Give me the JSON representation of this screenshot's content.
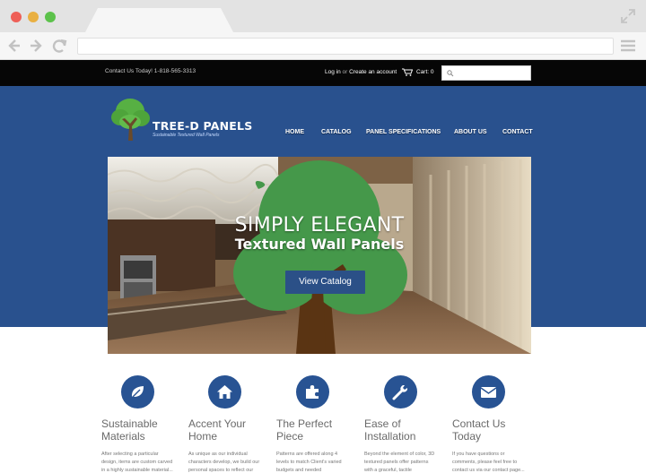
{
  "site": {
    "contact": "Contact Us Today! 1-818-565-3313",
    "login": "Log in",
    "or": "or",
    "create_account": "Create an account",
    "cart": "Cart: 0"
  },
  "logo": {
    "title": "TREE-D PANELS",
    "tagline": "Sustainable Textured Wall Panels"
  },
  "nav": [
    "HOME",
    "CATALOG",
    "PANEL SPECIFICATIONS",
    "ABOUT US",
    "CONTACT"
  ],
  "hero": {
    "line1": "SIMPLY ELEGANT",
    "line2": "Textured Wall Panels",
    "button": "View Catalog"
  },
  "features": [
    {
      "icon": "leaf-icon",
      "title1": "Sustainable",
      "title2": "Materials",
      "body1": "After selecting a particular",
      "body2": "design, items are custom carved",
      "body3": "in a highly sustainable material..."
    },
    {
      "icon": "home-icon",
      "title1": "Accent Your",
      "title2": "Home",
      "body1": "As unique as our individual",
      "body2": "characters develop, we build our",
      "body3": "personal spaces to reflect our"
    },
    {
      "icon": "puzzle-icon",
      "title1": "The Perfect",
      "title2": "Piece",
      "body1": "Patterns are offered along 4",
      "body2": "levels to match Client's varied",
      "body3": "budgets and needed"
    },
    {
      "icon": "wrench-icon",
      "title1": "Ease of",
      "title2": "Installation",
      "body1": "Beyond the element of color, 3D",
      "body2": "textured panels offer patterns",
      "body3": "with a graceful, tactile"
    },
    {
      "icon": "envelope-icon",
      "title1": "Contact Us",
      "title2": "Today",
      "body1": "If you have questions or",
      "body2": "comments, please feel free to",
      "body3": "contact us via our contact page..."
    }
  ],
  "colors": {
    "header_blue": "#29518e",
    "topbar_black": "#060606",
    "tree_green": "#45984a",
    "trunk_brown": "#5a3413"
  }
}
